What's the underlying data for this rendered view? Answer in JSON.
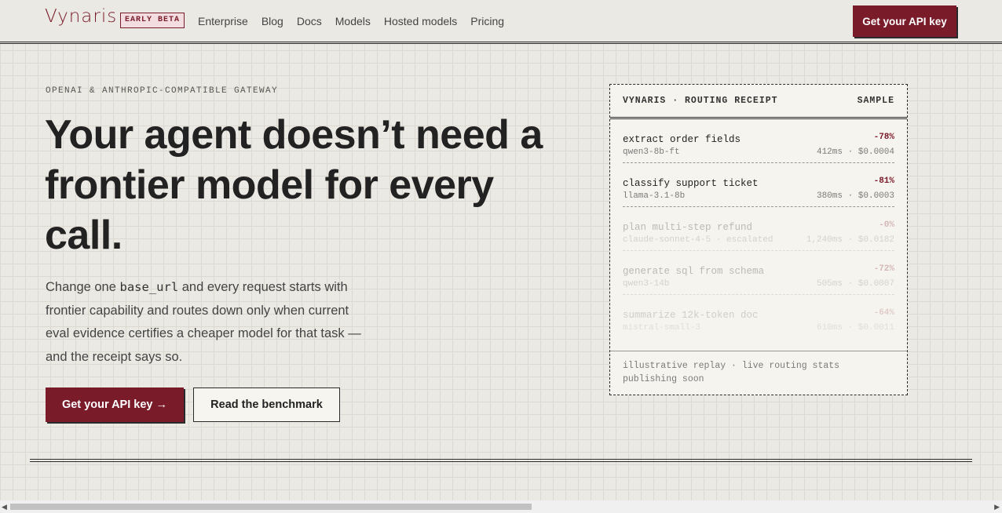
{
  "nav": {
    "logo": "Vynaris",
    "badge": "EARLY BETA",
    "links": [
      "Enterprise",
      "Blog",
      "Docs",
      "Models",
      "Hosted models",
      "Pricing"
    ],
    "cta": "Get your API key"
  },
  "hero": {
    "eyebrow": "OPENAI & ANTHROPIC-COMPATIBLE GATEWAY",
    "headline": "Your agent doesn’t need a frontier model for every call.",
    "lede_before": "Change one ",
    "lede_code": "base_url",
    "lede_after": " and every request starts with frontier capability and routes down only when current eval evidence certifies a cheaper model for that task — and the receipt says so.",
    "primary_cta": "Get your API key →",
    "secondary_cta": "Read the benchmark"
  },
  "receipt": {
    "title": "VYNARIS · ROUTING RECEIPT",
    "tag": "SAMPLE",
    "rows": [
      {
        "task": "extract order fields",
        "pct": "-78%",
        "model": "qwen3-8b-ft",
        "meta": "412ms · $0.0004"
      },
      {
        "task": "classify support ticket",
        "pct": "-81%",
        "model": "llama-3.1-8b",
        "meta": "380ms · $0.0003"
      },
      {
        "task": "plan multi-step refund",
        "pct": "-0%",
        "model": "claude-sonnet-4-5 · escalated",
        "meta": "1,240ms · $0.0182"
      },
      {
        "task": "generate sql from schema",
        "pct": "-72%",
        "model": "qwen3-14b",
        "meta": "505ms · $0.0007"
      },
      {
        "task": "summarize 12k-token doc",
        "pct": "-64%",
        "model": "mistral-small-3",
        "meta": "610ms · $0.0011"
      }
    ],
    "footer": "illustrative replay · live routing stats publishing soon"
  },
  "colors": {
    "accent": "#7a1b2a",
    "background": "#ebe9e3",
    "ink": "#222222"
  }
}
